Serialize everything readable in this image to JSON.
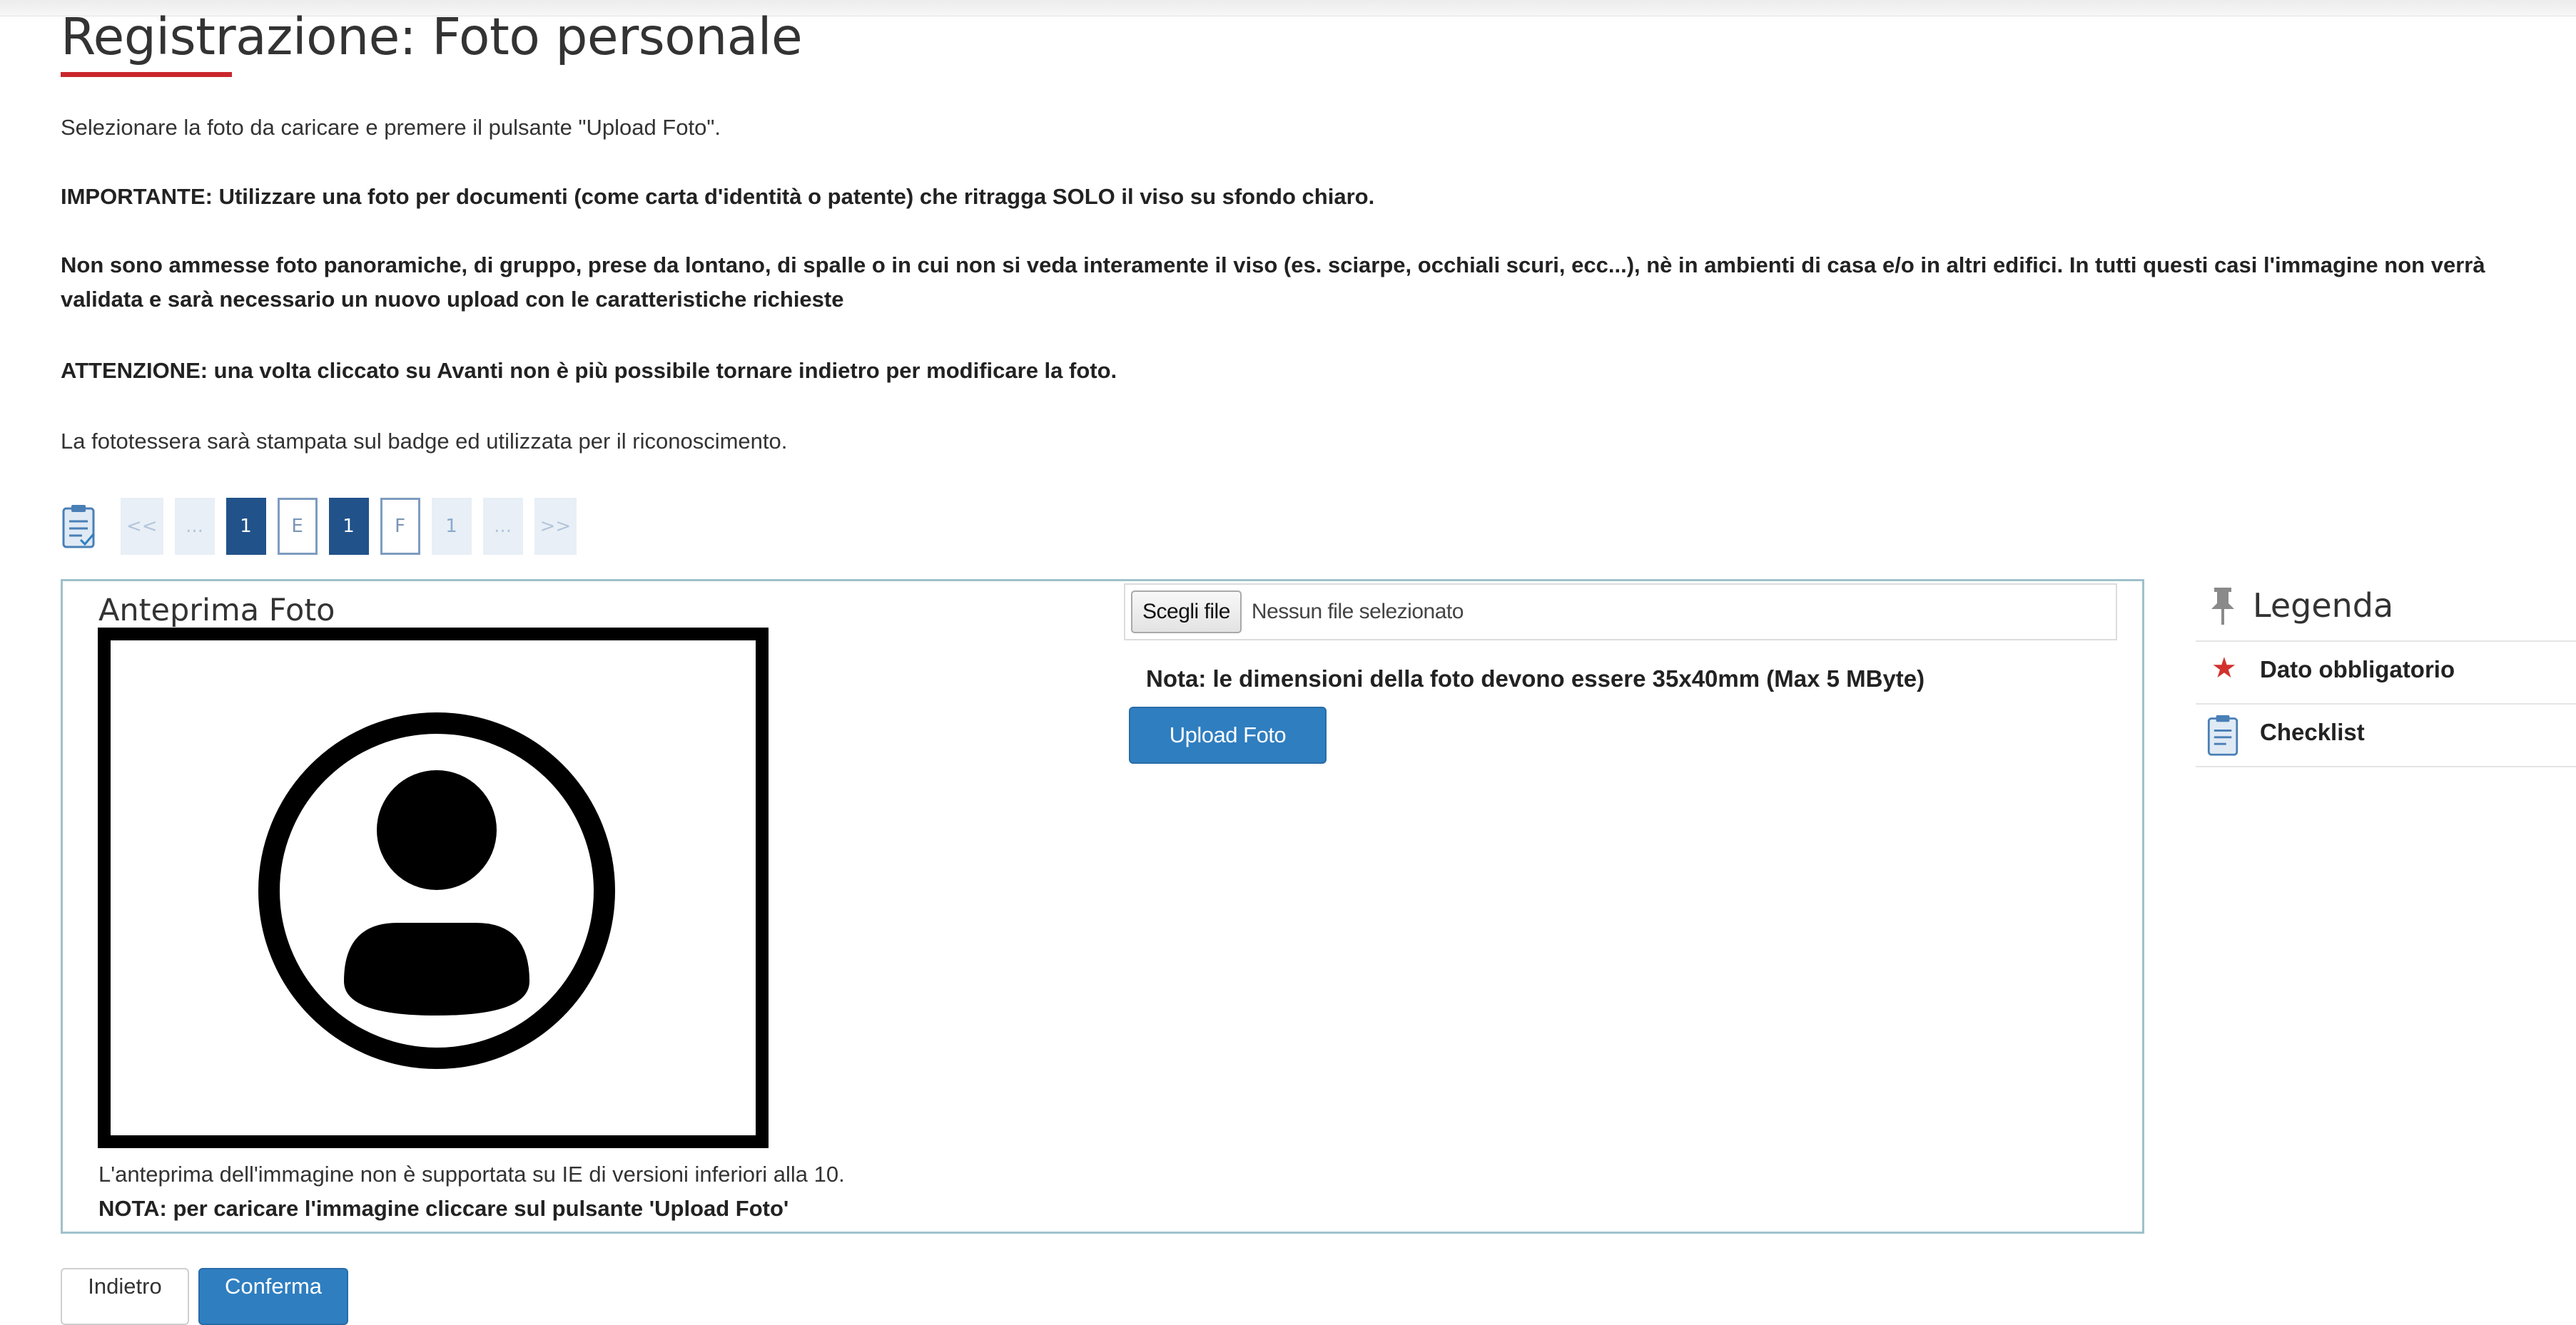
{
  "page": {
    "title": "Registrazione: Foto personale",
    "intro": "Selezionare la foto da caricare e premere il pulsante \"Upload Foto\".",
    "important": "IMPORTANTE: Utilizzare una foto per documenti (come carta d'identità o patente) che ritragga SOLO il viso su sfondo chiaro.",
    "not_allowed": "Non sono ammesse foto panoramiche, di gruppo, prese da lontano, di spalle o in cui non si veda interamente il viso (es. sciarpe, occhiali scuri, ecc...), nè in ambienti di casa e/o in altri edifici. In tutti questi casi l'immagine non verrà validata e sarà necessario un nuovo upload con le caratteristiche richieste",
    "warning": "ATTENZIONE: una volta cliccato su Avanti non è più possibile tornare indietro per modificare la foto.",
    "badge_note": "La fototessera sarà stampata sul badge ed utilizzata per il riconoscimento."
  },
  "pager": {
    "items": [
      "<<",
      "...",
      "1",
      "E",
      "1",
      "F",
      "1",
      "...",
      ">>"
    ],
    "active_color": "#21528a"
  },
  "preview": {
    "label": "Anteprima Foto",
    "ie_note": "L'anteprima dell'immagine non è supportata su IE di versioni inferiori alla 10.",
    "upload_note": "NOTA: per caricare l'immagine cliccare sul pulsante 'Upload Foto'",
    "placeholder_icon": "user-avatar-icon"
  },
  "upload": {
    "choose_file_label": "Scegli file",
    "no_file_text": "Nessun file selezionato",
    "size_note": "Nota: le dimensioni della foto devono essere 35x40mm (Max 5 MByte)",
    "upload_button": "Upload Foto",
    "button_color": "#2f7ec0"
  },
  "legend": {
    "title": "Legenda",
    "items": [
      {
        "icon": "asterisk-icon",
        "label": "Dato obbligatorio"
      },
      {
        "icon": "clipboard-icon",
        "label": "Checklist"
      }
    ],
    "required_color": "#d1322c"
  },
  "actions": {
    "back_label": "Indietro",
    "confirm_label": "Conferma"
  },
  "theme": {
    "title_underline": "#c9262b",
    "panel_border": "#9fc1cb"
  }
}
